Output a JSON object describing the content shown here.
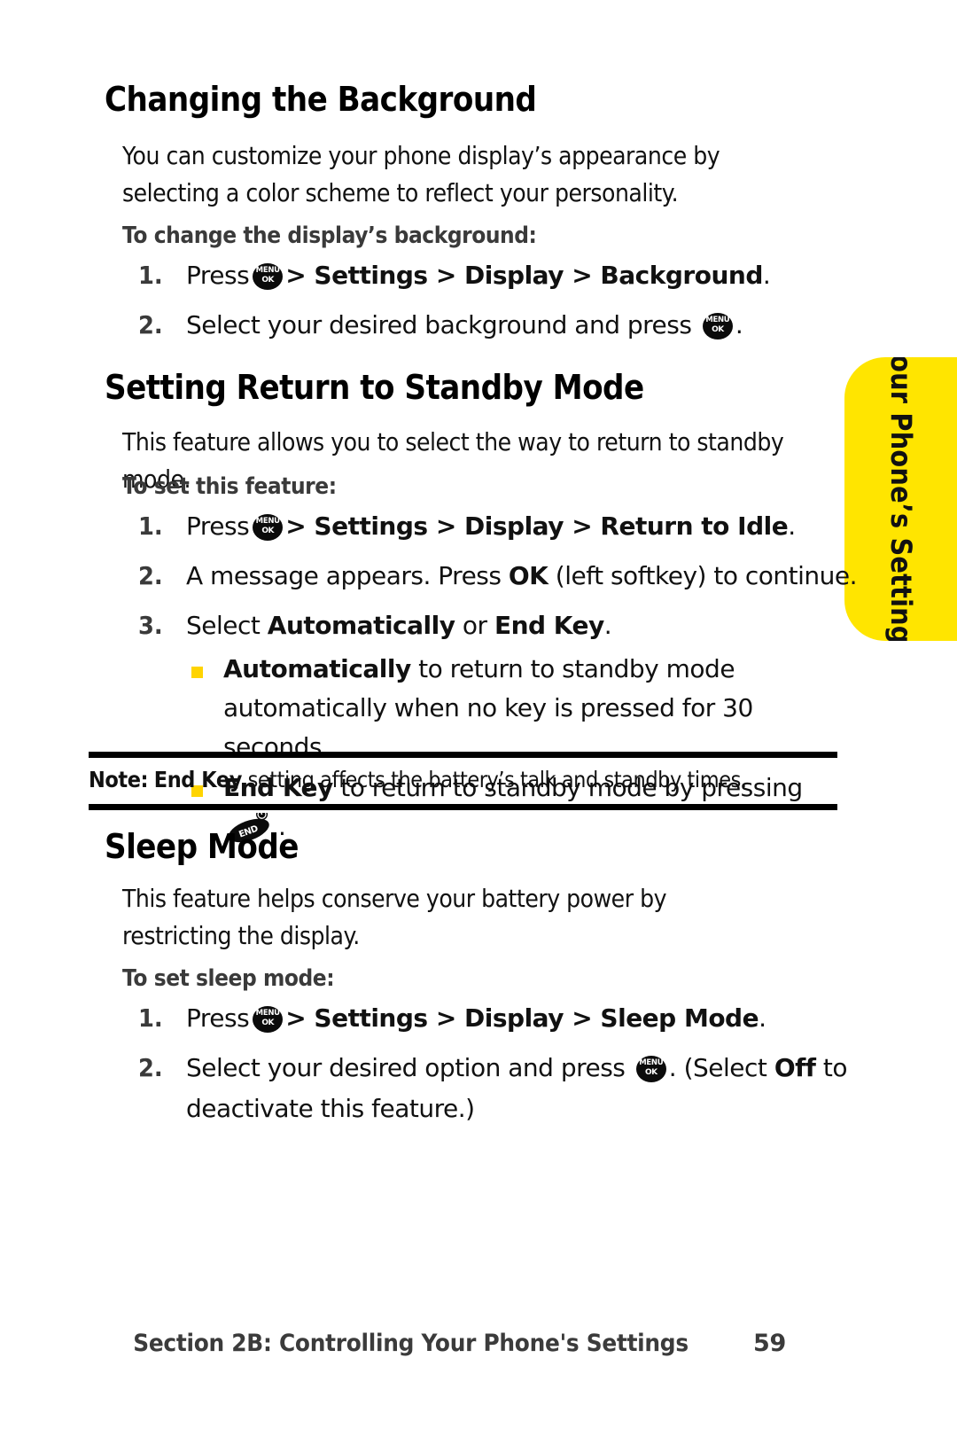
{
  "page": {
    "number": "59",
    "footer_section": "Section 2B: Controlling Your Phone's Settings",
    "side_tab_label": "Your Phone’s Settings",
    "accent_yellow": "#FFE500",
    "bullet_yellow": "#FFD400",
    "text_color": "#111111",
    "subhead_color": "#3A3A3A"
  },
  "icons": {
    "menu_ok_top": "MENU",
    "menu_ok_bottom": "OK",
    "end_key_label": "END",
    "menu_ok_name": "menu-ok-key-icon",
    "end_key_name": "end-key-icon"
  },
  "sections": [
    {
      "id": "changing-the-background",
      "title": "Changing the Background",
      "intro": "You can customize your phone display’s appearance by selecting a color scheme to reflect your personality.",
      "subhead": "To change the display’s background:",
      "steps": [
        {
          "num": "1.",
          "pre": "Press",
          "icon": "menu-ok",
          "post_plain": "",
          "post_bold_path": "> Settings > Display > Background",
          "tail": "."
        },
        {
          "num": "2.",
          "pre": "Select your desired background and press",
          "icon": "menu-ok",
          "post_plain": "",
          "post_bold_path": "",
          "tail": "."
        }
      ]
    },
    {
      "id": "setting-return-to-standby-mode",
      "title": "Setting Return to Standby Mode",
      "intro": "This feature allows you to select the way to return to standby mode.",
      "subhead": "To set this feature:",
      "steps": [
        {
          "num": "1.",
          "pre": "Press",
          "icon": "menu-ok",
          "post_bold_path": "> Settings > Display > Return to Idle",
          "tail": "."
        },
        {
          "num": "2.",
          "text_a": "A message appears. Press ",
          "bold_b": "OK",
          "text_c": " (left softkey) to continue."
        },
        {
          "num": "3.",
          "text_a": "Select ",
          "bold_b": "Automatically",
          "text_c": " or ",
          "bold_d": "End Key",
          "text_e": ".",
          "subbullets": [
            {
              "bold": "Automatically",
              "rest": " to return to standby mode automatically when no key is pressed for 30 seconds."
            },
            {
              "bold": "End Key",
              "rest": " to return to standby mode by pressing",
              "icon": "end-key",
              "tail": "."
            }
          ]
        }
      ],
      "note": {
        "label": "Note:",
        "bold_term": "End Key",
        "rest": " setting affects the battery’s talk and standby times."
      }
    },
    {
      "id": "sleep-mode",
      "title": "Sleep Mode",
      "intro": "This feature helps conserve your battery power by restricting the display.",
      "subhead": "To set sleep mode:",
      "steps": [
        {
          "num": "1.",
          "pre": "Press",
          "icon": "menu-ok",
          "post_bold_path": "> Settings > Display > Sleep Mode",
          "tail": "."
        },
        {
          "num": "2.",
          "text_a": "Select your desired option and press ",
          "icon": "menu-ok",
          "text_c": ". (Select ",
          "bold_d": "Off",
          "text_e": " to deactivate this feature.)"
        }
      ]
    }
  ]
}
